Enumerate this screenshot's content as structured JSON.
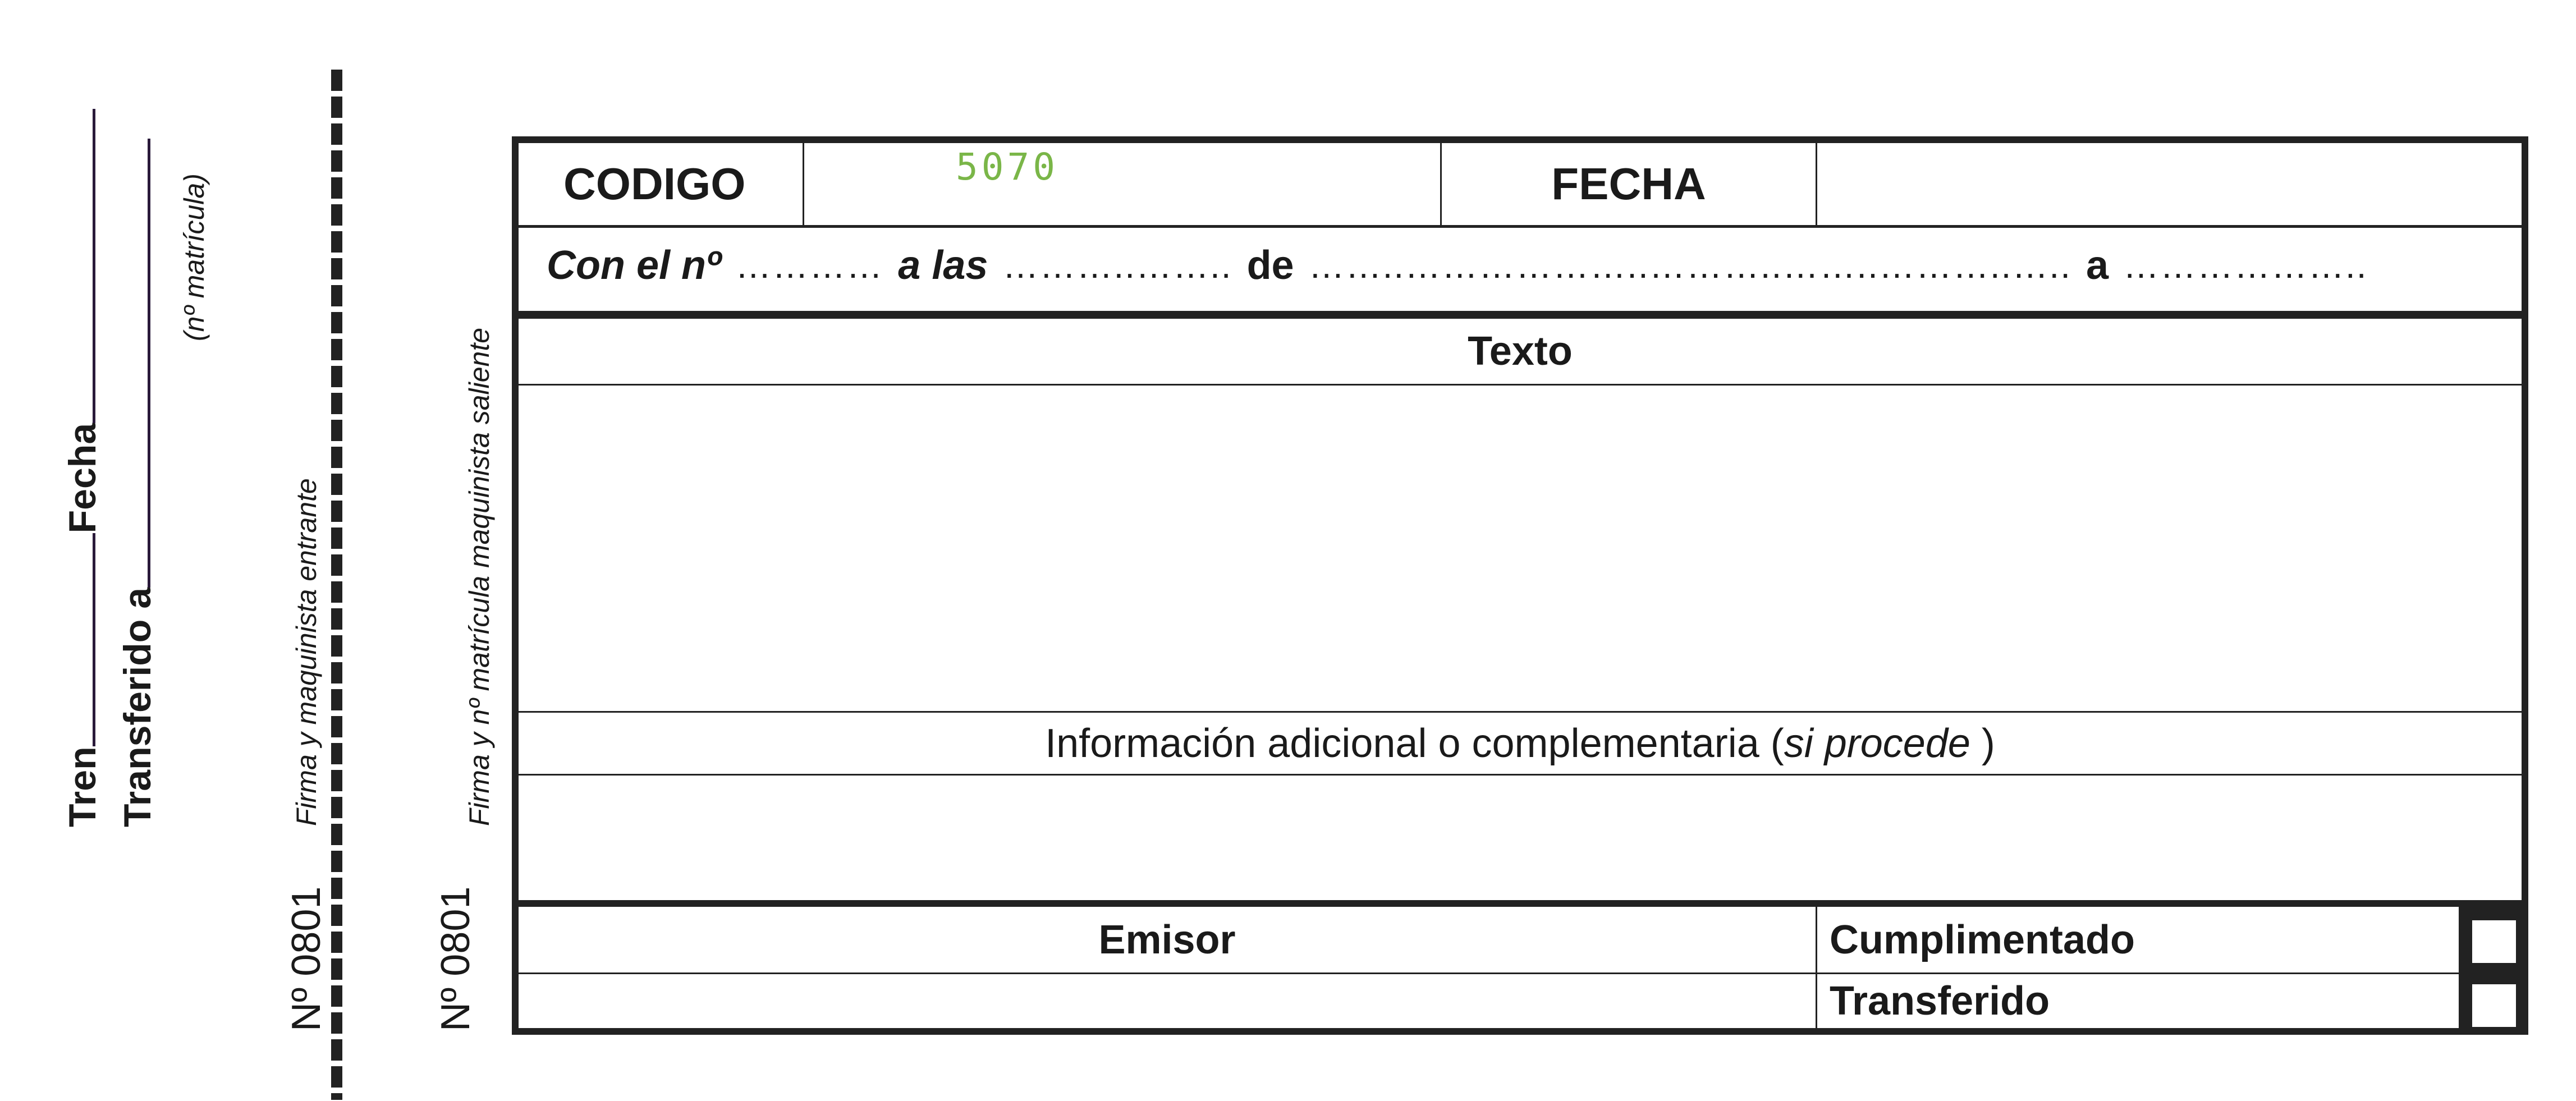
{
  "stub": {
    "tren_label": "Tren",
    "fecha_label": "Fecha",
    "transferido_label": "Transferido a",
    "matricula_note": "(nº matrícula)",
    "firma_entrante": "Firma y maquinista entrante",
    "numero_stub": "Nº 0801"
  },
  "side": {
    "firma_saliente": "Firma y nº matrícula maquinista saliente",
    "numero": "Nº 0801"
  },
  "form": {
    "codigo_label": "CODIGO",
    "codigo_value": "5070",
    "codigo_value_color": "#7ab648",
    "fecha_label": "FECHA",
    "fecha_value": "",
    "con_el_label": "Con el nº",
    "dots1": "…………",
    "a_las_label": "a las",
    "dots2": "………..……..",
    "de_label": "de",
    "dots3": "……..………………..………..……..………..…..",
    "a_label": "a",
    "dots4": "………………..",
    "texto_header": "Texto",
    "info_header": "Información adicional o complementaria (",
    "info_header_italic": "si procede",
    "info_header_end": " )",
    "emisor_label": "Emisor",
    "cumplimentado_label": "Cumplimentado",
    "transferido_label": "Transferido"
  }
}
